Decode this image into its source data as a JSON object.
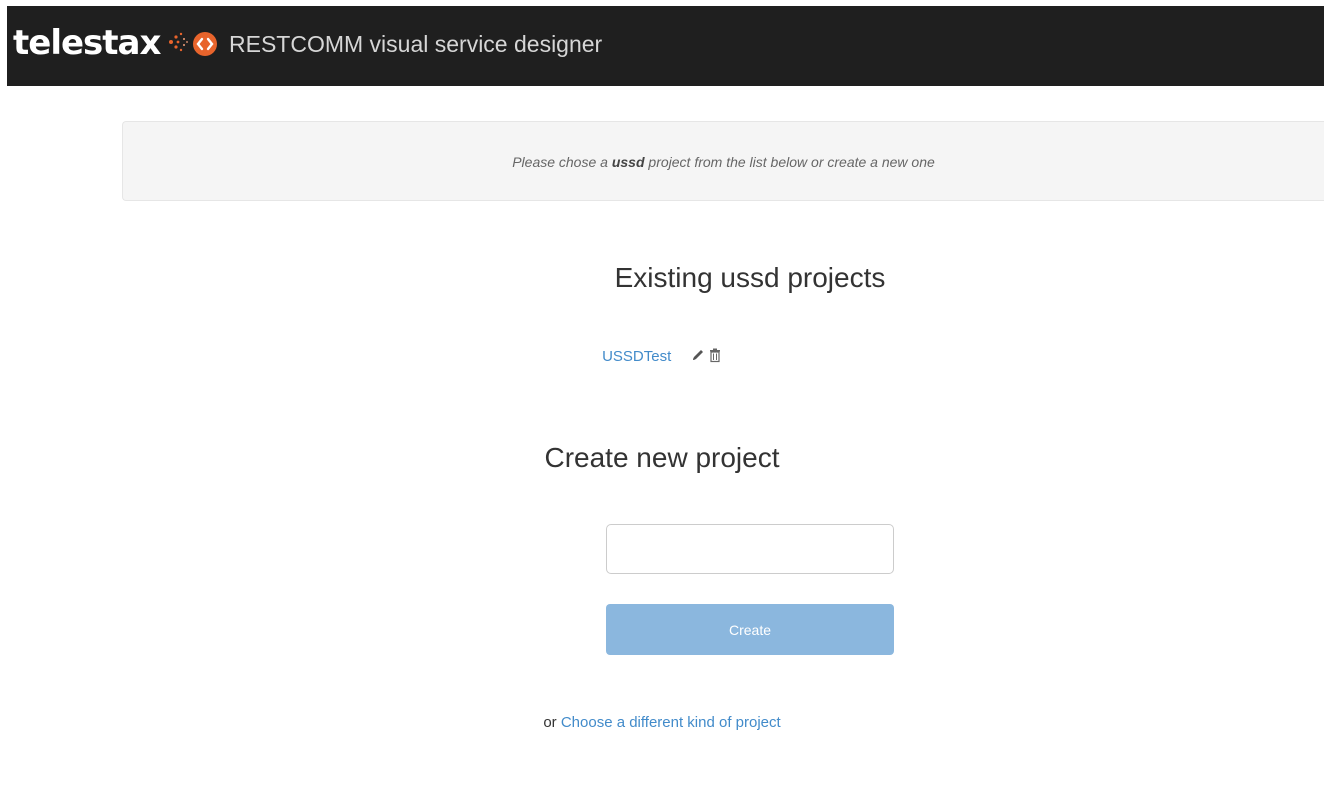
{
  "header": {
    "logo_text": "telestax",
    "app_title": "RESTCOMM visual service designer",
    "colors": {
      "bar": "#1f1f1f",
      "brand_orange": "#e8642c"
    }
  },
  "notice": {
    "prefix": "Please chose a",
    "emphasis": "ussd",
    "suffix": "project from the list below or create a new one"
  },
  "existing": {
    "title": "Existing ussd projects",
    "projects": [
      {
        "name": "USSDTest",
        "actions": [
          "pencil-icon",
          "trash-icon"
        ]
      }
    ]
  },
  "create": {
    "title": "Create new project",
    "input_value": "",
    "input_placeholder": "",
    "button_label": "Create"
  },
  "alternative": {
    "prefix": "or",
    "link_label": "Choose a different kind of project"
  },
  "colors": {
    "link": "#428bca",
    "button": "#8bb7de"
  }
}
